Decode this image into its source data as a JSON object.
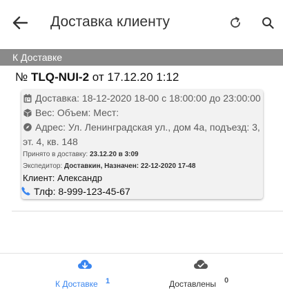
{
  "header": {
    "title": "Доставка клиенту",
    "back_icon": "arrow-left-icon",
    "refresh_icon": "refresh-icon",
    "search_icon": "search-icon"
  },
  "section": {
    "title": "К Доставке"
  },
  "order": {
    "prefix": "№",
    "number": "TLQ-NUI-2",
    "date": "от 17.12.20 1:12",
    "delivery": "Доставка: 18-12-2020 18-00 с 18:00:00 до 23:00:00",
    "weight": "Вес: Объем: Мест:",
    "address_line1": "Адрес: Ул. Ленинградская ул., дом 4а, подъезд: 3,",
    "address_line2": "эт. 4, кв. 148",
    "accepted_label": "Принято в доставку:",
    "accepted_value": "23.12.20 в 3:09",
    "courier_label": "Экспедитор:",
    "courier_value": "Доставкин, Назначен: 22-12-2020 17-48",
    "client": "Клиент: Александр",
    "phone": "Тлф: 8-999-123-45-67"
  },
  "bottom_nav": {
    "tabs": [
      {
        "label": "К Доставке",
        "badge": "1",
        "icon": "cloud-download-icon",
        "active": true
      },
      {
        "label": "Доставлены",
        "badge": "0",
        "icon": "cloud-check-icon",
        "active": false
      }
    ]
  },
  "colors": {
    "accent": "#3a86f0",
    "section_header": "#8a8a8a",
    "card_bg": "#f2f2f2"
  }
}
